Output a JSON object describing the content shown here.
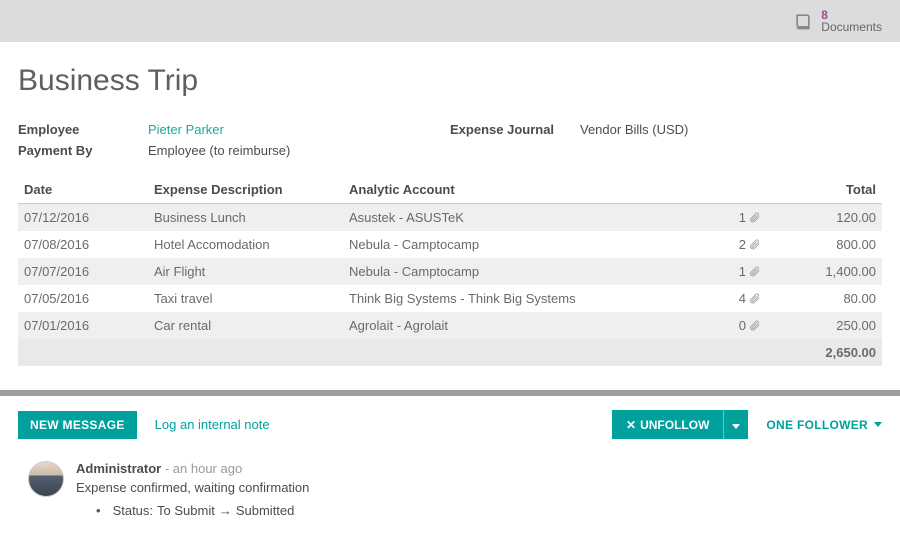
{
  "topbar": {
    "documents_count": "8",
    "documents_label": "Documents"
  },
  "title": "Business Trip",
  "fields": {
    "employee_label": "Employee",
    "employee_value": "Pieter Parker",
    "payment_by_label": "Payment By",
    "payment_by_value": "Employee (to reimburse)",
    "expense_journal_label": "Expense Journal",
    "expense_journal_value": "Vendor Bills (USD)"
  },
  "table": {
    "headers": {
      "date": "Date",
      "desc": "Expense Description",
      "analytic": "Analytic Account",
      "total": "Total"
    },
    "rows": [
      {
        "date": "07/12/2016",
        "desc": "Business Lunch",
        "analytic": "Asustek - ASUSTeK",
        "attach": "1",
        "total": "120.00"
      },
      {
        "date": "07/08/2016",
        "desc": "Hotel Accomodation",
        "analytic": "Nebula - Camptocamp",
        "attach": "2",
        "total": "800.00"
      },
      {
        "date": "07/07/2016",
        "desc": "Air Flight",
        "analytic": "Nebula - Camptocamp",
        "attach": "1",
        "total": "1,400.00"
      },
      {
        "date": "07/05/2016",
        "desc": "Taxi travel",
        "analytic": "Think Big Systems - Think Big Systems",
        "attach": "4",
        "total": "80.00"
      },
      {
        "date": "07/01/2016",
        "desc": "Car rental",
        "analytic": "Agrolait - Agrolait",
        "attach": "0",
        "total": "250.00"
      }
    ],
    "grand_total": "2,650.00"
  },
  "chatter": {
    "new_message": "NEW MESSAGE",
    "log_note": "Log an internal note",
    "unfollow": "UNFOLLOW",
    "followers": "ONE FOLLOWER",
    "message": {
      "author": "Administrator",
      "time": "- an hour ago",
      "body": "Expense confirmed, waiting confirmation",
      "status_label": "Status:",
      "status_from": "To Submit",
      "status_to": "Submitted"
    }
  }
}
